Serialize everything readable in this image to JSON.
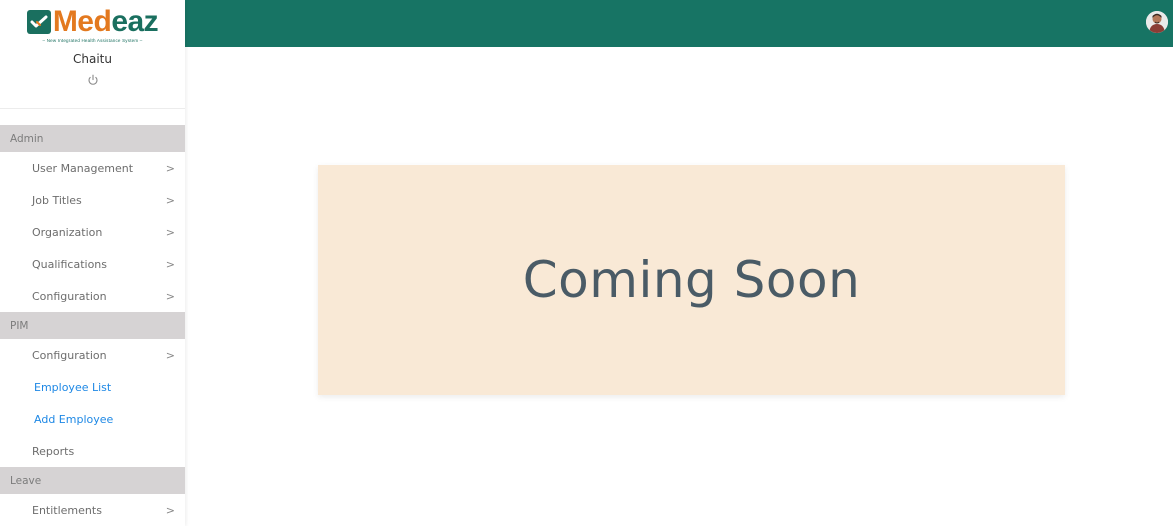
{
  "brand": {
    "name_part1": "Med",
    "name_part2": "eaz",
    "tagline": "– New Integrated Health Assistance System –",
    "primary_color": "#177464",
    "accent_color": "#e3791f"
  },
  "user": {
    "name": "Chaitu",
    "logout_icon": "power-icon"
  },
  "sidebar": {
    "sections": [
      {
        "label": "Admin",
        "items": [
          {
            "label": "User Management",
            "chevron": true
          },
          {
            "label": "Job Titles",
            "chevron": true
          },
          {
            "label": "Organization",
            "chevron": true
          },
          {
            "label": "Qualifications",
            "chevron": true
          },
          {
            "label": "Configuration",
            "chevron": true
          }
        ]
      },
      {
        "label": "PIM",
        "items": [
          {
            "label": "Configuration",
            "chevron": true
          },
          {
            "label": "Employee List",
            "chevron": false
          },
          {
            "label": "Add Employee",
            "chevron": false
          },
          {
            "label": "Reports",
            "chevron": false
          }
        ]
      },
      {
        "label": "Leave",
        "items": [
          {
            "label": "Entitlements",
            "chevron": true
          }
        ]
      }
    ],
    "chevron_glyph": ">"
  },
  "main": {
    "message": "Coming Soon",
    "card_color": "#f9e9d6",
    "text_color": "#4a5b66"
  }
}
